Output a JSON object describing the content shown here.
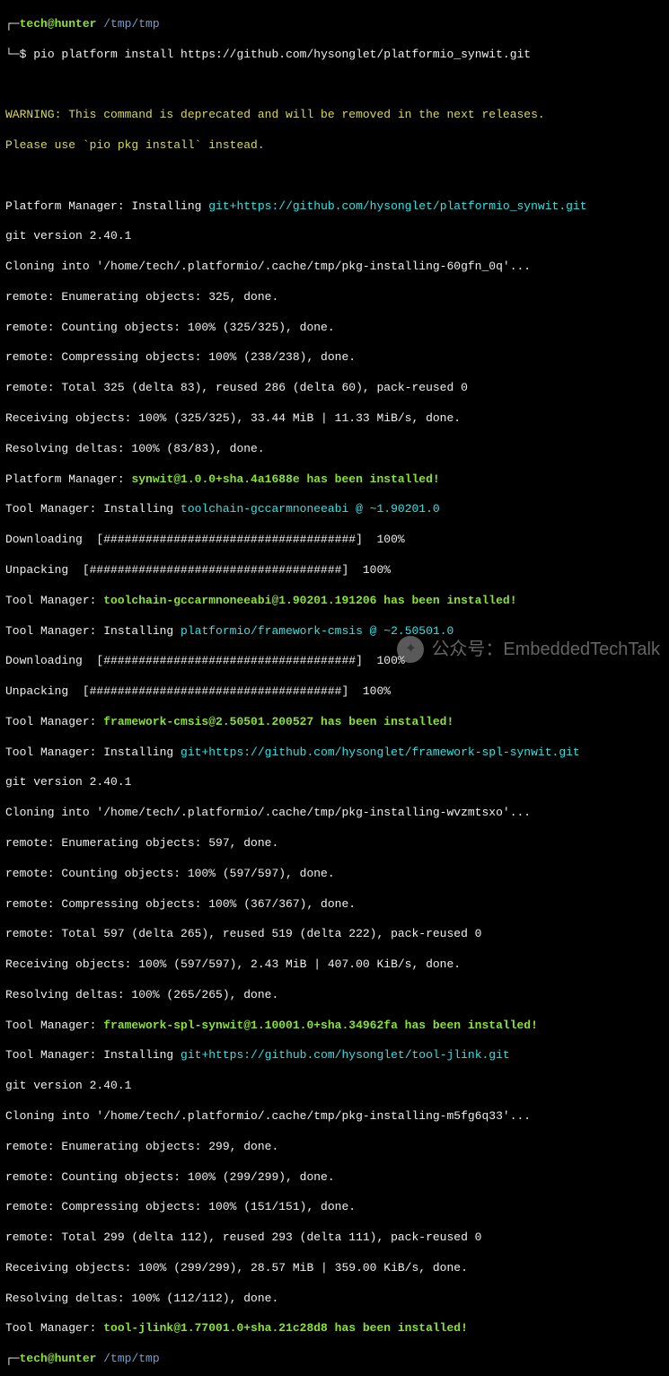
{
  "prompt1": {
    "bracket_open": "┌─",
    "user_host": "tech@hunter",
    "cwd": "/tmp/tmp",
    "bracket_cmd": "└─",
    "ps": "$ ",
    "command": "pio platform install https://github.com/hysonglet/platformio_synwit.git"
  },
  "prompt2": {
    "bracket_open": "┌─",
    "user_host": "tech@hunter",
    "cwd": "/tmp/tmp"
  },
  "warning": {
    "l1": "WARNING: This command is deprecated and will be removed in the next releases.",
    "l2": "Please use `pio pkg install` instead."
  },
  "pm": {
    "installing_prefix": "Platform Manager: Installing ",
    "installing_url": "git+https://github.com/hysonglet/platformio_synwit.git",
    "installed_prefix": "Platform Manager: ",
    "installed_msg": "synwit@1.0.0+sha.4a1688e has been installed!"
  },
  "git1": {
    "l1": "git version 2.40.1",
    "l2": "Cloning into '/home/tech/.platformio/.cache/tmp/pkg-installing-60gfn_0q'...",
    "l3": "remote: Enumerating objects: 325, done.",
    "l4": "remote: Counting objects: 100% (325/325), done.",
    "l5": "remote: Compressing objects: 100% (238/238), done.",
    "l6": "remote: Total 325 (delta 83), reused 286 (delta 60), pack-reused 0",
    "l7": "Receiving objects: 100% (325/325), 33.44 MiB | 11.33 MiB/s, done.",
    "l8": "Resolving deltas: 100% (83/83), done."
  },
  "tm1": {
    "installing_prefix": "Tool Manager: Installing ",
    "installing_pkg": "toolchain-gccarmnoneeabi @ ~1.90201.0",
    "download": "Downloading  [####################################]  100%",
    "unpack": "Unpacking  [####################################]  100%",
    "done_prefix": "Tool Manager: ",
    "done_msg": "toolchain-gccarmnoneeabi@1.90201.191206 has been installed!"
  },
  "tm2": {
    "installing_prefix": "Tool Manager: Installing ",
    "installing_pkg": "platformio/framework-cmsis @ ~2.50501.0",
    "download": "Downloading  [####################################]  100%",
    "unpack": "Unpacking  [####################################]  100%",
    "done_prefix": "Tool Manager: ",
    "done_msg": "framework-cmsis@2.50501.200527 has been installed!"
  },
  "tm3": {
    "installing_prefix": "Tool Manager: Installing ",
    "installing_pkg": "git+https://github.com/hysonglet/framework-spl-synwit.git",
    "done_prefix": "Tool Manager: ",
    "done_msg": "framework-spl-synwit@1.10001.0+sha.34962fa has been installed!"
  },
  "git2": {
    "l1": "git version 2.40.1",
    "l2": "Cloning into '/home/tech/.platformio/.cache/tmp/pkg-installing-wvzmtsxo'...",
    "l3": "remote: Enumerating objects: 597, done.",
    "l4": "remote: Counting objects: 100% (597/597), done.",
    "l5": "remote: Compressing objects: 100% (367/367), done.",
    "l6": "remote: Total 597 (delta 265), reused 519 (delta 222), pack-reused 0",
    "l7": "Receiving objects: 100% (597/597), 2.43 MiB | 407.00 KiB/s, done.",
    "l8": "Resolving deltas: 100% (265/265), done."
  },
  "tm4": {
    "installing_prefix": "Tool Manager: Installing ",
    "installing_pkg": "git+https://github.com/hysonglet/tool-jlink.git",
    "done_prefix": "Tool Manager: ",
    "done_msg": "tool-jlink@1.77001.0+sha.21c28d8 has been installed!"
  },
  "git3": {
    "l1": "git version 2.40.1",
    "l2": "Cloning into '/home/tech/.platformio/.cache/tmp/pkg-installing-m5fg6q33'...",
    "l3": "remote: Enumerating objects: 299, done.",
    "l4": "remote: Counting objects: 100% (299/299), done.",
    "l5": "remote: Compressing objects: 100% (151/151), done.",
    "l6": "remote: Total 299 (delta 112), reused 293 (delta 111), pack-reused 0",
    "l7": "Receiving objects: 100% (299/299), 28.57 MiB | 359.00 KiB/s, done.",
    "l8": "Resolving deltas: 100% (112/112), done."
  },
  "watermark": {
    "label": "公众号：EmbeddedTechTalk"
  }
}
